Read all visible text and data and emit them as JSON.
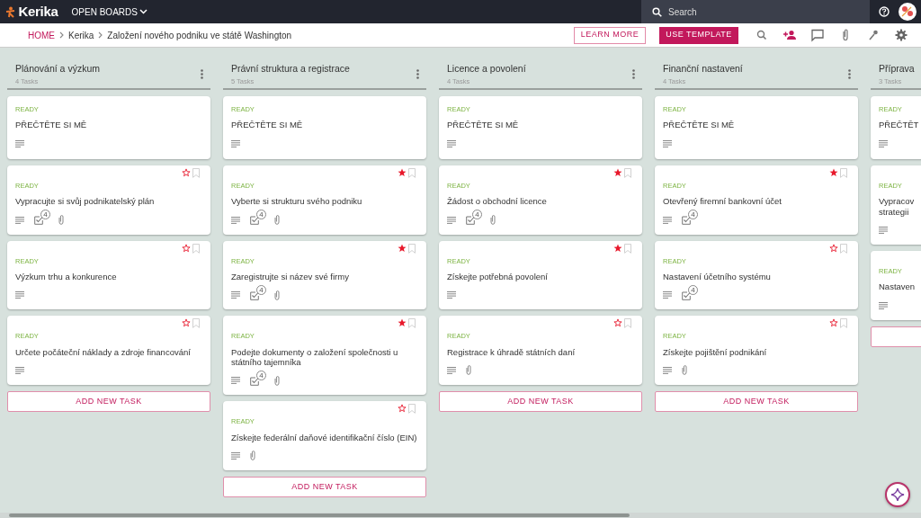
{
  "topbar": {
    "logo": "Kerika",
    "menu": "OPEN BOARDS",
    "search": {
      "placeholder": "Search"
    }
  },
  "breadcrumb": [
    "HOME",
    "Kerika",
    "Založení nového podniku ve státě Washington"
  ],
  "actions": {
    "learn_more": "LEARN MORE",
    "use_template": "USE TEMPLATE"
  },
  "columns": [
    {
      "title": "Plánování a výzkum",
      "count": "4 Tasks",
      "add_button": {
        "label": "ADD NEW TASK"
      },
      "cards": [
        {
          "kind": "readme",
          "status": "READY",
          "title": "PŘEČTĚTE SI MĚ",
          "badges": [
            {
              "kind": "notes"
            }
          ]
        },
        {
          "kind": "task",
          "starred": false,
          "status": "READY",
          "title": "Vypracujte si svůj podnikatelský plán",
          "badges": [
            {
              "kind": "notes"
            },
            {
              "kind": "checklist",
              "count": "4"
            },
            {
              "kind": "attachment"
            }
          ]
        },
        {
          "kind": "task",
          "starred": false,
          "status": "READY",
          "title": "Výzkum trhu a konkurence",
          "badges": [
            {
              "kind": "notes"
            }
          ]
        },
        {
          "kind": "task",
          "starred": false,
          "status": "READY",
          "title": "Určete počáteční náklady a zdroje financování",
          "badges": [
            {
              "kind": "notes"
            }
          ]
        }
      ]
    },
    {
      "title": "Právní struktura a registrace",
      "count": "5 Tasks",
      "add_button": {
        "label": "ADD NEW TASK"
      },
      "cards": [
        {
          "kind": "readme",
          "status": "READY",
          "title": "PŘEČTĚTE SI MĚ",
          "badges": [
            {
              "kind": "notes"
            }
          ]
        },
        {
          "kind": "task",
          "starred": true,
          "status": "READY",
          "title": "Vyberte si strukturu svého podniku",
          "badges": [
            {
              "kind": "notes"
            },
            {
              "kind": "checklist",
              "count": "4"
            },
            {
              "kind": "attachment"
            }
          ]
        },
        {
          "kind": "task",
          "starred": true,
          "status": "READY",
          "title": "Zaregistrujte si název své firmy",
          "badges": [
            {
              "kind": "notes"
            },
            {
              "kind": "checklist",
              "count": "4"
            },
            {
              "kind": "attachment"
            }
          ]
        },
        {
          "kind": "task",
          "starred": true,
          "status": "READY",
          "title": "Podejte dokumenty o založení společnosti u státního tajemníka",
          "badges": [
            {
              "kind": "notes"
            },
            {
              "kind": "checklist",
              "count": "4"
            },
            {
              "kind": "attachment"
            }
          ]
        },
        {
          "kind": "task",
          "starred": false,
          "status": "READY",
          "title": "Získejte federální daňové identifikační číslo (EIN)",
          "badges": [
            {
              "kind": "notes"
            },
            {
              "kind": "attachment"
            }
          ]
        }
      ]
    },
    {
      "title": "Licence a povolení",
      "count": "4 Tasks",
      "add_button": {
        "label": "ADD NEW TASK"
      },
      "cards": [
        {
          "kind": "readme",
          "status": "READY",
          "title": "PŘEČTĚTE SI MĚ",
          "badges": [
            {
              "kind": "notes"
            }
          ]
        },
        {
          "kind": "task",
          "starred": true,
          "status": "READY",
          "title": "Žádost o obchodní licence",
          "badges": [
            {
              "kind": "notes"
            },
            {
              "kind": "checklist",
              "count": "4"
            },
            {
              "kind": "attachment"
            }
          ]
        },
        {
          "kind": "task",
          "starred": true,
          "status": "READY",
          "title": "Získejte potřebná povolení",
          "badges": [
            {
              "kind": "notes"
            }
          ]
        },
        {
          "kind": "task",
          "starred": false,
          "status": "READY",
          "title": "Registrace k úhradě státních daní",
          "badges": [
            {
              "kind": "notes"
            },
            {
              "kind": "attachment"
            }
          ]
        }
      ]
    },
    {
      "title": "Finanční nastavení",
      "count": "4 Tasks",
      "add_button": {
        "label": "ADD NEW TASK"
      },
      "cards": [
        {
          "kind": "readme",
          "status": "READY",
          "title": "PŘEČTĚTE SI MĚ",
          "badges": [
            {
              "kind": "notes"
            }
          ]
        },
        {
          "kind": "task",
          "starred": true,
          "status": "READY",
          "title": "Otevřený firemní bankovní účet",
          "badges": [
            {
              "kind": "notes"
            },
            {
              "kind": "checklist",
              "count": "4"
            }
          ]
        },
        {
          "kind": "task",
          "starred": false,
          "status": "READY",
          "title": "Nastavení účetního systému",
          "badges": [
            {
              "kind": "notes"
            },
            {
              "kind": "checklist",
              "count": "4"
            }
          ]
        },
        {
          "kind": "task",
          "starred": false,
          "status": "READY",
          "title": "Získejte pojištění podnikání",
          "badges": [
            {
              "kind": "notes"
            },
            {
              "kind": "attachment"
            }
          ]
        }
      ]
    },
    {
      "title": "Příprava",
      "count": "3 Tasks",
      "cards": [
        {
          "kind": "readme",
          "status": "READY",
          "title": "PŘEČTĚT",
          "badges": [
            {
              "kind": "notes"
            }
          ]
        },
        {
          "kind": "task",
          "status": "READY",
          "title": "Vypracov\nstrategii",
          "badges": [
            {
              "kind": "notes"
            }
          ]
        },
        {
          "kind": "task",
          "status": "READY",
          "title": "Nastaven",
          "badges": [
            {
              "kind": "notes"
            }
          ]
        }
      ]
    }
  ]
}
